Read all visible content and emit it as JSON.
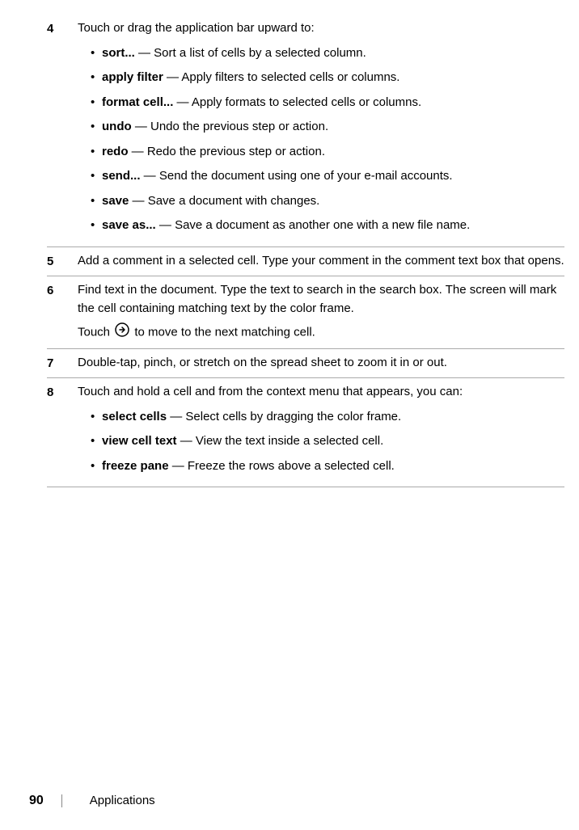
{
  "steps": [
    {
      "number": "4",
      "intro": "Touch or drag the application bar upward to:",
      "items": [
        {
          "term": "sort...",
          "desc": " — Sort a list of cells by a selected column."
        },
        {
          "term": "apply filter",
          "desc": " — Apply filters to selected cells or columns."
        },
        {
          "term": "format cell...",
          "desc": " — Apply formats to selected cells or columns."
        },
        {
          "term": "undo",
          "desc": " — Undo the previous step or action."
        },
        {
          "term": "redo",
          "desc": " — Redo the previous step or action."
        },
        {
          "term": "send...",
          "desc": " — Send the document using one of your e-mail accounts."
        },
        {
          "term": "save",
          "desc": " — Save a document with changes."
        },
        {
          "term": "save as...",
          "desc": " — Save a document as another one with a new file name."
        }
      ]
    },
    {
      "number": "5",
      "text": "Add a comment in a selected cell. Type your comment in the comment text box that opens."
    },
    {
      "number": "6",
      "text_a": "Find text in the document. Type the text to search in the search box. The screen will mark the cell containing matching text by the color frame.",
      "text_b_pre": "Touch ",
      "text_b_post": " to move to the next matching cell."
    },
    {
      "number": "7",
      "text": "Double-tap, pinch, or stretch on the spread sheet to zoom it in or out."
    },
    {
      "number": "8",
      "intro": "Touch and hold a cell and from the context menu that appears, you can:",
      "items": [
        {
          "term": "select cells",
          "desc": " — Select cells by dragging the color frame."
        },
        {
          "term": "view cell text",
          "desc": " — View the text inside a selected cell."
        },
        {
          "term": "freeze pane",
          "desc": " — Freeze the rows above a selected cell."
        }
      ]
    }
  ],
  "footer": {
    "page_number": "90",
    "section": "Applications"
  }
}
